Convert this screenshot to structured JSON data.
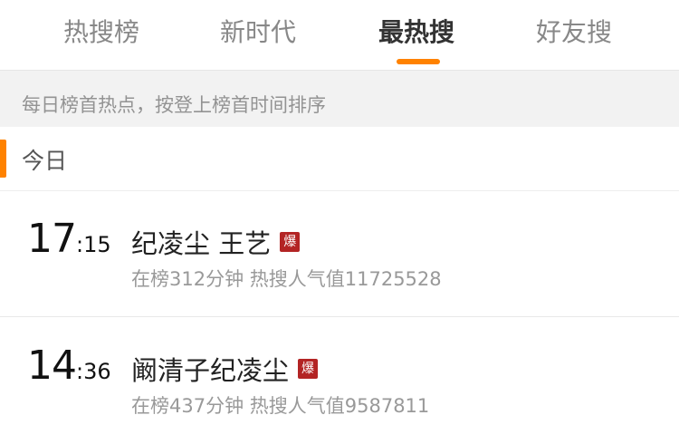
{
  "tabs": [
    {
      "label": "热搜榜"
    },
    {
      "label": "新时代"
    },
    {
      "label": "最热搜"
    },
    {
      "label": "好友搜"
    }
  ],
  "active_tab": "最热搜",
  "notice": "每日榜首热点，按登上榜首时间排序",
  "section": {
    "title": "今日"
  },
  "items": [
    {
      "hour": "17",
      "minute": ":15",
      "title": "纪凌尘 王艺",
      "badge": "爆",
      "meta": "在榜312分钟 热搜人气值11725528"
    },
    {
      "hour": "14",
      "minute": ":36",
      "title": "阚清子纪凌尘",
      "badge": "爆",
      "meta": "在榜437分钟 热搜人气值9587811"
    }
  ],
  "colors": {
    "accent": "#ff8200",
    "badge": "#b32424"
  }
}
